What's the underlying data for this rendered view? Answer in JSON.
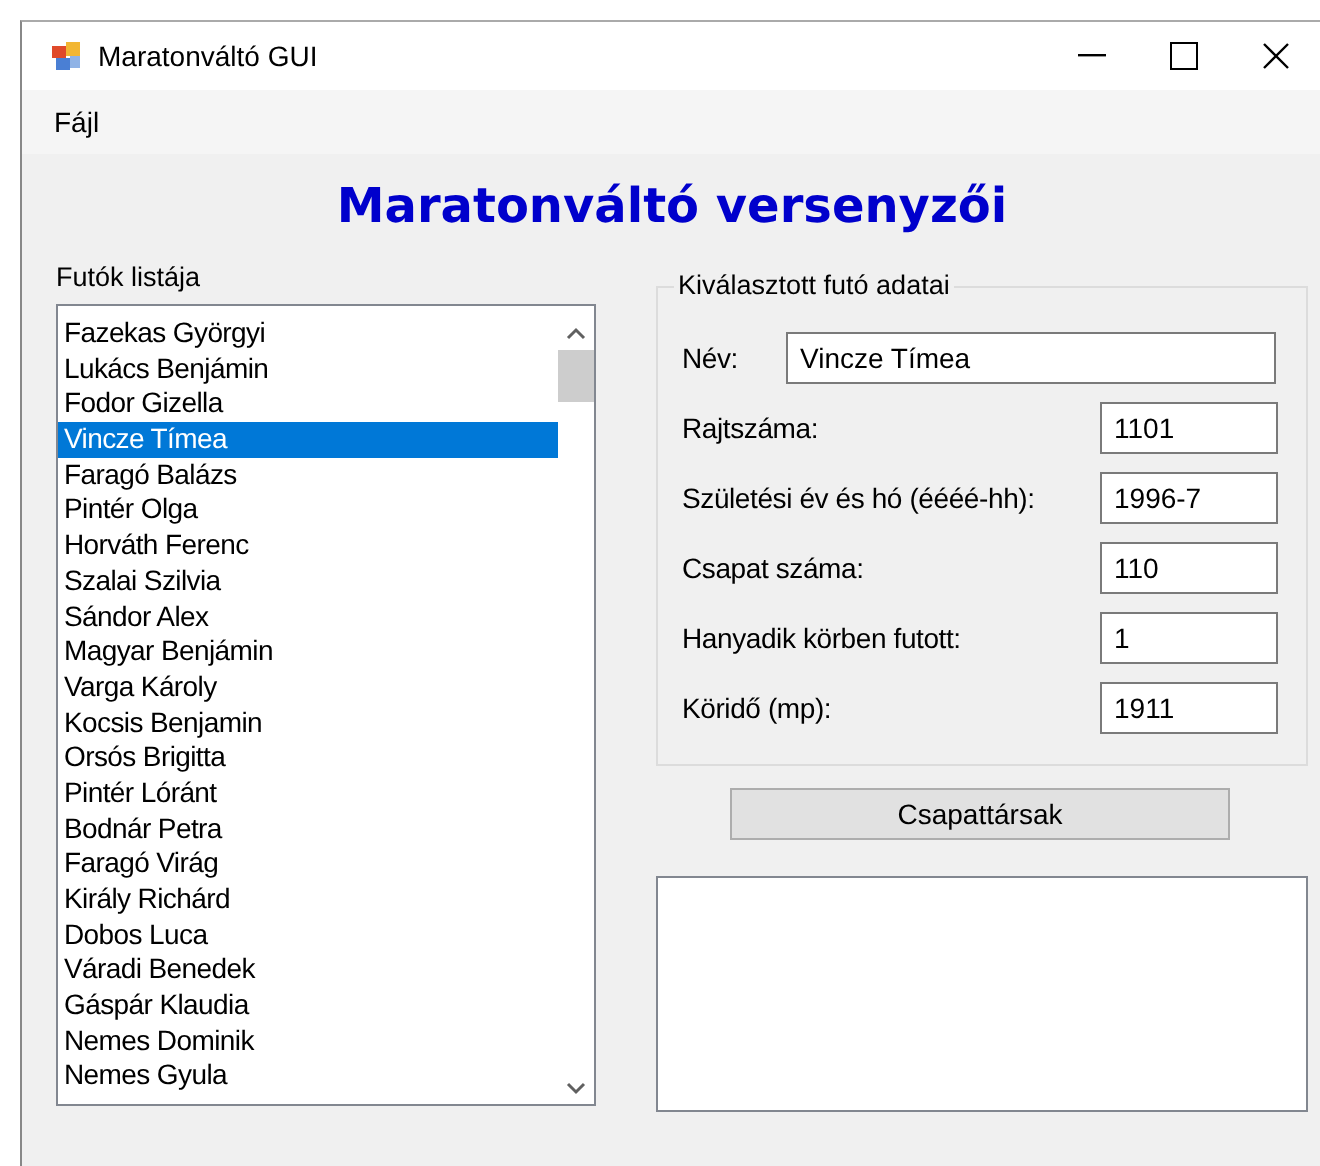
{
  "window": {
    "title": "Maratonváltó GUI"
  },
  "menu": [
    "Fájl"
  ],
  "heading": "Maratonváltó versenyzői",
  "runner_list": {
    "label": "Futók listája",
    "items": [
      {
        "name": "Fazekas Györgyi",
        "selected": false
      },
      {
        "name": "Lukács Benjámin",
        "selected": false
      },
      {
        "name": "Fodor Gizella",
        "selected": false
      },
      {
        "name": "Vincze Tímea",
        "selected": true
      },
      {
        "name": "Faragó Balázs",
        "selected": false
      },
      {
        "name": "Pintér Olga",
        "selected": false
      },
      {
        "name": "Horváth Ferenc",
        "selected": false
      },
      {
        "name": "Szalai Szilvia",
        "selected": false
      },
      {
        "name": "Sándor Alex",
        "selected": false
      },
      {
        "name": "Magyar Benjámin",
        "selected": false
      },
      {
        "name": "Varga Károly",
        "selected": false
      },
      {
        "name": "Kocsis Benjamin",
        "selected": false
      },
      {
        "name": "Orsós Brigitta",
        "selected": false
      },
      {
        "name": "Pintér Lóránt",
        "selected": false
      },
      {
        "name": "Bodnár Petra",
        "selected": false
      },
      {
        "name": "Faragó Virág",
        "selected": false
      },
      {
        "name": "Király Richárd",
        "selected": false
      },
      {
        "name": "Dobos Luca",
        "selected": false
      },
      {
        "name": "Váradi Benedek",
        "selected": false
      },
      {
        "name": "Gáspár Klaudia",
        "selected": false
      },
      {
        "name": "Nemes Dominik",
        "selected": false
      },
      {
        "name": "Nemes Gyula",
        "selected": false
      }
    ]
  },
  "details": {
    "label": "Kiválasztott futó adatai",
    "name_field": {
      "label": "Név:",
      "value": "Vincze Tímea"
    },
    "fields": [
      {
        "label": "Rajtszáma:",
        "value": "1101"
      },
      {
        "label": "Születési év és hó (éééé-hh):",
        "value": "1996-7"
      },
      {
        "label": "Csapat száma:",
        "value": "110"
      },
      {
        "label": "Hanyadik körben futott:",
        "value": "1"
      },
      {
        "label": "Köridő (mp):",
        "value": "1911"
      }
    ]
  },
  "teammates_button": "Csapattársak"
}
